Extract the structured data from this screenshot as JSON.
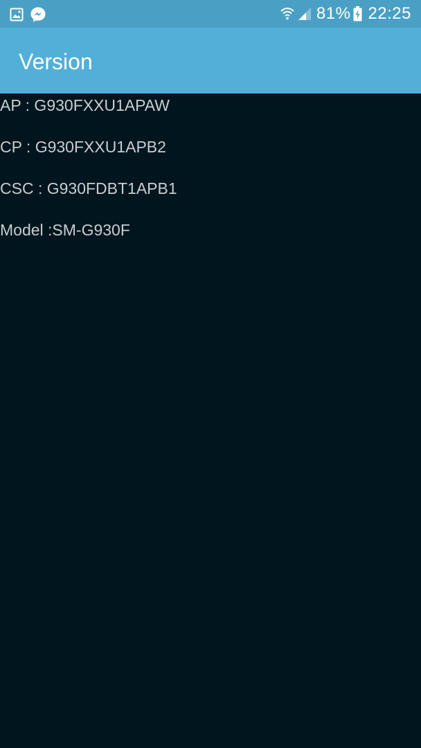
{
  "status_bar": {
    "left_icons": [
      "gallery-icon",
      "messenger-icon"
    ],
    "right_icons": [
      "wifi-icon",
      "cellular-signal-icon",
      "battery-charging-icon"
    ],
    "battery_percent": "81%",
    "time": "22:25"
  },
  "app_bar": {
    "title": "Version"
  },
  "info": [
    {
      "text": "AP : G930FXXU1APAW"
    },
    {
      "text": "CP : G930FXXU1APB2"
    },
    {
      "text": "CSC : G930FDBT1APB1"
    },
    {
      "text": "Model :SM-G930F"
    }
  ],
  "colors": {
    "status_bar": "#4aa0c4",
    "app_bar": "#52b0d8",
    "background": "#01151f",
    "text": "#c9cdcf"
  }
}
